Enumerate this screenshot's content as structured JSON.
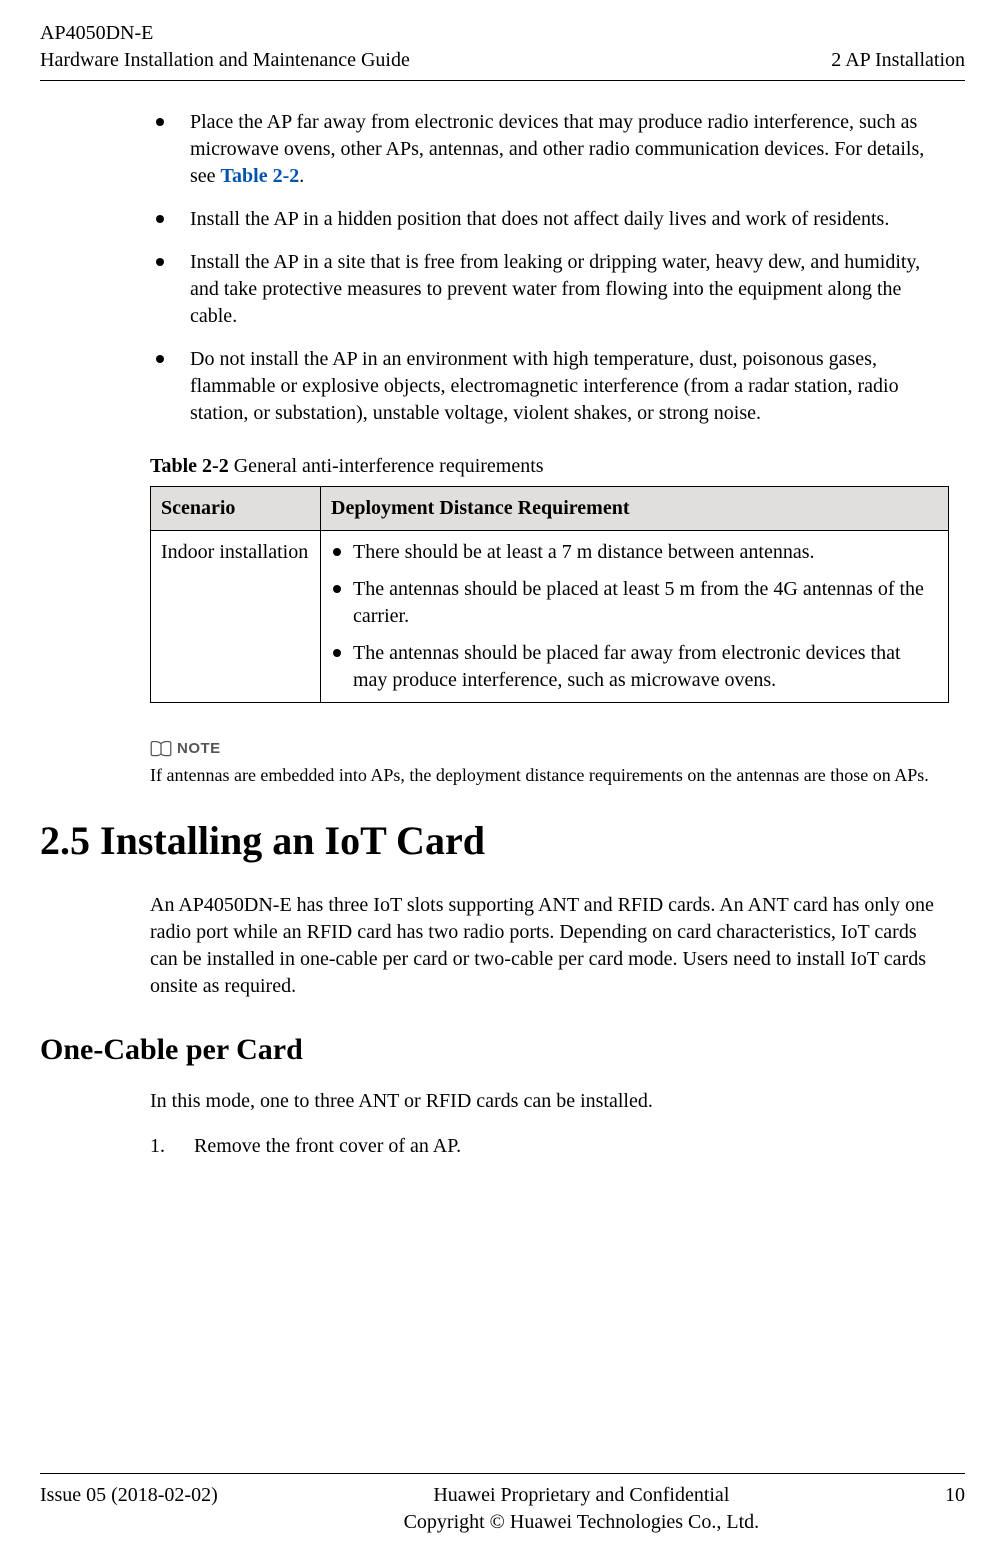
{
  "header": {
    "product": "AP4050DN-E",
    "doc_title": "Hardware Installation and Maintenance Guide",
    "chapter": "2 AP Installation"
  },
  "bullets": [
    {
      "pre": "Place the AP far away from electronic devices that may produce radio interference, such as microwave ovens, other APs, antennas, and other radio communication devices. For details, see ",
      "ref": "Table 2-2",
      "post": "."
    },
    {
      "pre": "Install the AP in a hidden position that does not affect daily lives and work of residents."
    },
    {
      "pre": "Install the AP in a site that is free from leaking or dripping water, heavy dew, and humidity, and take protective measures to prevent water from flowing into the equipment along the cable."
    },
    {
      "pre": "Do not install the AP in an environment with high temperature, dust, poisonous gases, flammable or explosive objects, electromagnetic interference (from a radar station, radio station, or substation), unstable voltage, violent shakes, or strong noise."
    }
  ],
  "table": {
    "caption_bold": "Table 2-2",
    "caption_rest": " General anti-interference requirements",
    "headers": {
      "col1": "Scenario",
      "col2": "Deployment Distance Requirement"
    },
    "row": {
      "scenario": "Indoor installation",
      "items": [
        "There should be at least a 7 m distance between antennas.",
        "The antennas should be placed at least 5 m from the 4G antennas of the carrier.",
        "The antennas should be placed far away from electronic devices that may produce interference, such as microwave ovens."
      ]
    }
  },
  "note": {
    "label": "NOTE",
    "text": "If antennas are embedded into APs, the deployment distance requirements on the antennas are those on APs."
  },
  "section25": {
    "title": "2.5 Installing an IoT Card",
    "intro": "An AP4050DN-E has three IoT slots supporting ANT and RFID cards. An ANT card has only one radio port while an RFID card has two radio ports. Depending on card characteristics, IoT cards can be installed in one-cable per card or two-cable per card mode. Users need to install IoT cards onsite as required.",
    "sub_heading": "One-Cable per Card",
    "sub_intro": "In this mode, one to three ANT or RFID cards can be installed.",
    "steps": [
      "Remove the front cover of an AP."
    ]
  },
  "footer": {
    "issue": "Issue 05 (2018-02-02)",
    "center1": "Huawei Proprietary and Confidential",
    "center2": "Copyright © Huawei Technologies Co., Ltd.",
    "page_no": "10"
  }
}
